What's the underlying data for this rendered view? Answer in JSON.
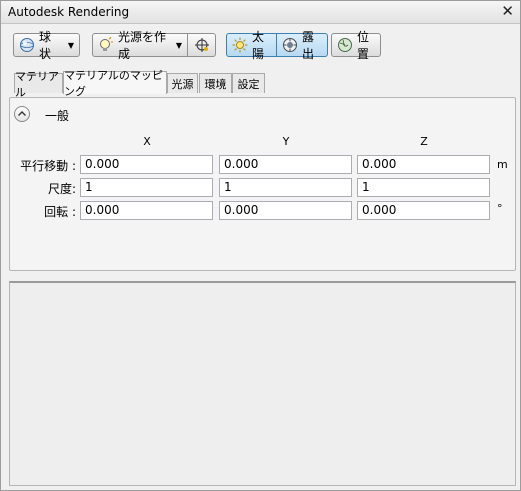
{
  "window": {
    "title": "Autodesk Rendering",
    "close_glyph": "✕"
  },
  "toolbar": {
    "sphere_label": "球状",
    "create_light_label": "光源を作成",
    "sun_label": "太陽",
    "exposure_label": "露出",
    "location_label": "位置"
  },
  "tabs": [
    "マテリアル",
    "マテリアルのマッピング",
    "光源",
    "環境",
    "設定"
  ],
  "section": {
    "title": "一般",
    "columns": [
      "X",
      "Y",
      "Z"
    ],
    "rows": [
      {
        "label": "平行移動 :",
        "values": [
          "0.000",
          "0.000",
          "0.000"
        ],
        "unit": "m"
      },
      {
        "label": "尺度:",
        "values": [
          "1",
          "1",
          "1"
        ],
        "unit": ""
      },
      {
        "label": "回転 :",
        "values": [
          "0.000",
          "0.000",
          "0.000"
        ],
        "unit": "°"
      }
    ]
  },
  "accent_color": "#3c7fb1"
}
